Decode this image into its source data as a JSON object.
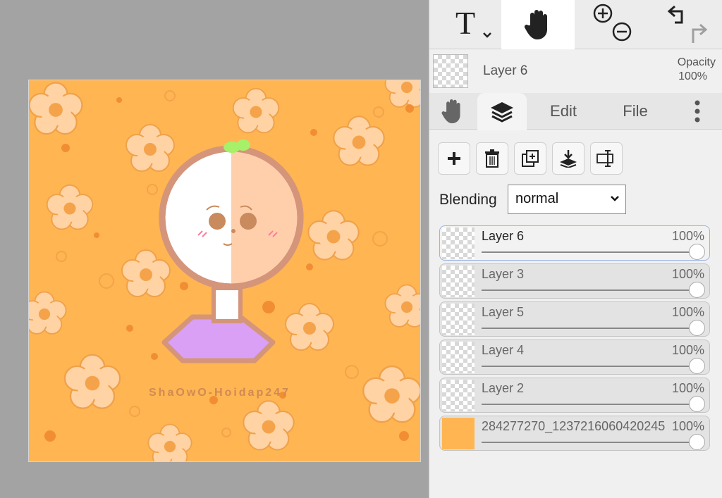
{
  "toolbar": {
    "text_tool_glyph": "T",
    "text_tool_icon": "text-icon",
    "hand_tool_icon": "hand-icon",
    "zoom_in_icon": "zoom-in-icon",
    "zoom_out_icon": "zoom-out-icon",
    "undo_icon": "undo-icon",
    "redo_icon": "redo-icon"
  },
  "current_layer": {
    "name": "Layer 6",
    "opacity_label": "Opacity",
    "opacity_value": "100%"
  },
  "tabs": [
    {
      "icon": "hand-icon"
    },
    {
      "icon": "layers-icon",
      "active": true
    },
    {
      "label": "Edit"
    },
    {
      "label": "File"
    },
    {
      "icon": "more-vertical-icon"
    }
  ],
  "layer_actions": [
    {
      "icon": "add-layer-icon"
    },
    {
      "icon": "delete-layer-icon"
    },
    {
      "icon": "duplicate-layer-icon"
    },
    {
      "icon": "merge-down-icon"
    },
    {
      "icon": "transform-icon"
    }
  ],
  "blending": {
    "label": "Blending",
    "value": "normal"
  },
  "layers": [
    {
      "name": "Layer 6",
      "opacity": "100%",
      "opacity_fraction": 1.0,
      "active": true
    },
    {
      "name": "Layer 3",
      "opacity": "100%",
      "opacity_fraction": 1.0
    },
    {
      "name": "Layer 5",
      "opacity": "100%",
      "opacity_fraction": 1.0
    },
    {
      "name": "Layer 4",
      "opacity": "100%",
      "opacity_fraction": 1.0
    },
    {
      "name": "Layer 2",
      "opacity": "100%",
      "opacity_fraction": 1.0
    },
    {
      "name": "284277270_1237216060420245",
      "opacity": "100%",
      "opacity_fraction": 1.0
    }
  ],
  "canvas": {
    "watermark": "ShaOwO-Hoidap247",
    "background_color": "#ffb552",
    "flower_color": "#ffd3a4",
    "flower_outline": "#f09a3a",
    "shirt_color": "#d9a0f5",
    "sprout_color": "#a6f06a"
  }
}
